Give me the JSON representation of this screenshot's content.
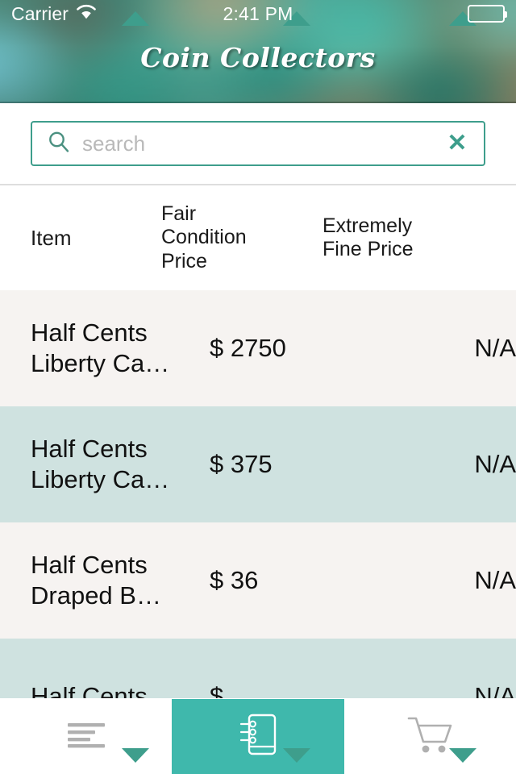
{
  "status_bar": {
    "carrier": "Carrier",
    "wifi_icon": "wifi-icon",
    "time": "2:41 PM",
    "battery_icon": "battery-full-icon"
  },
  "header": {
    "title": "Coin Collectors"
  },
  "search": {
    "icon": "search-icon",
    "value": "",
    "placeholder": "search",
    "clear_label": "✕",
    "clear_icon": "close-icon"
  },
  "table": {
    "columns": [
      {
        "label": "Item",
        "sortable": true,
        "sort_up": "▲",
        "sort_down": "▼"
      },
      {
        "label": "Fair\nCondition\nPrice",
        "sortable": true,
        "sort_up": "▲",
        "sort_down": "▼"
      },
      {
        "label": "Extremely\nFine Price",
        "sortable": true,
        "sort_up": "▲",
        "sort_down": "▼"
      }
    ],
    "rows": [
      {
        "item": "Half Cents\nLiberty Ca…",
        "fair": "$ 2750",
        "fine": "N/A"
      },
      {
        "item": "Half Cents\nLiberty Ca…",
        "fair": "$ 375",
        "fine": "N/A"
      },
      {
        "item": "Half Cents\nDraped B…",
        "fair": "$ 36",
        "fine": "N/A"
      },
      {
        "item": "Half Cents",
        "fair": "$",
        "fine": "N/A"
      }
    ]
  },
  "tabbar": {
    "tabs": [
      {
        "name": "list",
        "icon": "list-lines-icon",
        "active": false
      },
      {
        "name": "catalog",
        "icon": "notebook-icon",
        "active": true
      },
      {
        "name": "cart",
        "icon": "shopping-cart-icon",
        "active": false
      }
    ]
  },
  "colors": {
    "accent_teal": "#3fb8ac",
    "sort_arrow_teal": "#3e9e8c",
    "search_border": "#3e9e8c",
    "row_light": "#f6f3f1",
    "row_tinted": "#cfe2e0",
    "tab_inactive_icon": "#b0b0b0"
  }
}
